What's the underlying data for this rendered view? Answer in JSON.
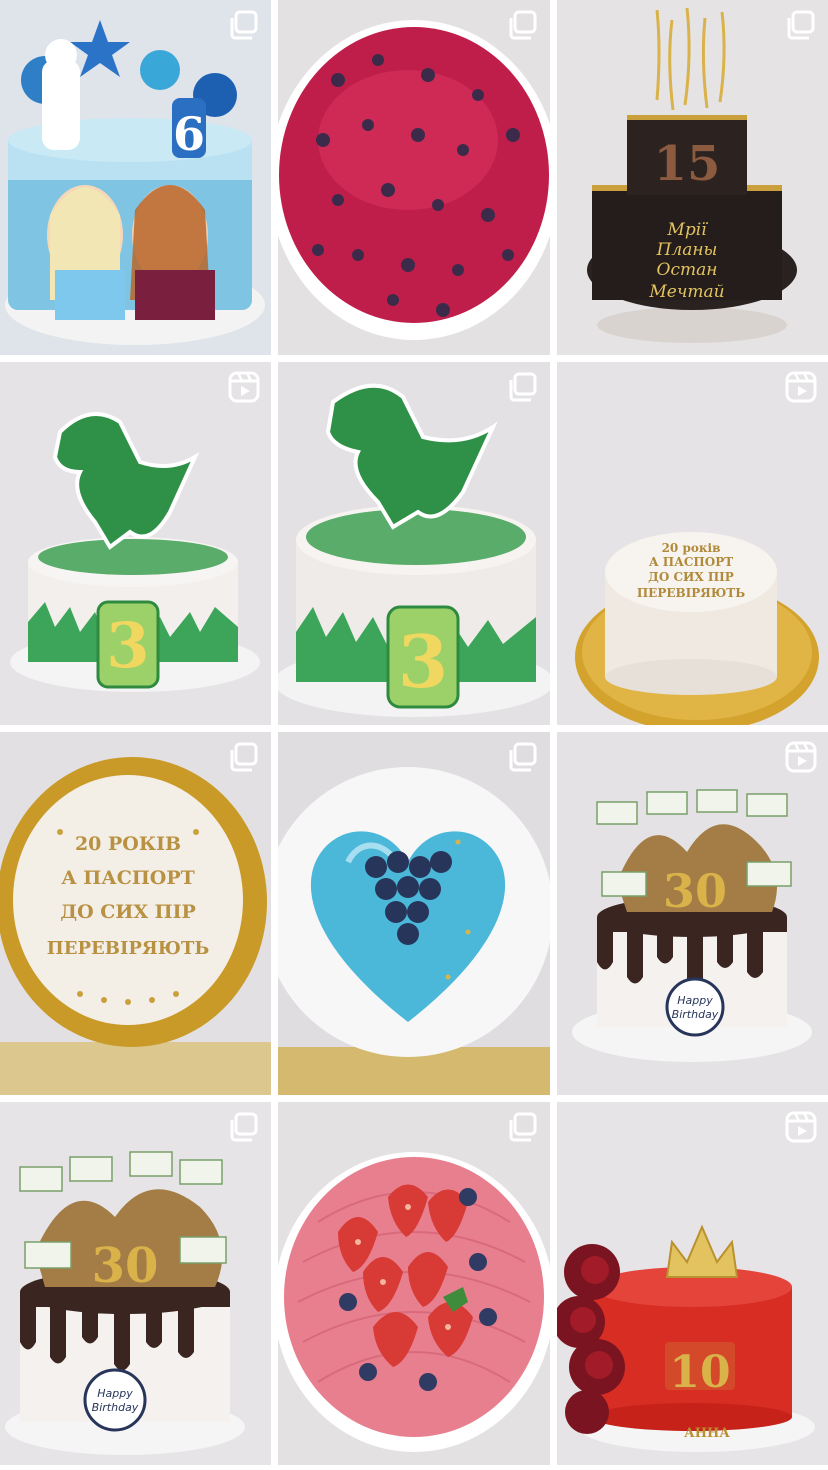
{
  "grid": {
    "columns": 3,
    "tiles": [
      {
        "name": "frozen-cake",
        "badge": "carousel-icon",
        "number": "6"
      },
      {
        "name": "berry-glaze-cake",
        "badge": "carousel-icon"
      },
      {
        "name": "black-gold-cake",
        "badge": "carousel-icon",
        "number": "15",
        "script_lines": [
          "Мрії",
          "Планы",
          "Остан",
          "Мечтай"
        ]
      },
      {
        "name": "dino-cake-1",
        "badge": "reels-icon",
        "number": "3"
      },
      {
        "name": "dino-cake-2",
        "badge": "carousel-icon",
        "number": "3"
      },
      {
        "name": "passport-cake-side",
        "badge": "reels-icon",
        "text_lines": [
          "20 років",
          "А ПАСПОРТ",
          "ДО СИХ ПІР",
          "ПЕРЕВІРЯЮТЬ"
        ]
      },
      {
        "name": "passport-cake-top",
        "badge": "carousel-icon",
        "text_lines": [
          "20 РОКІВ",
          "А ПАСПОРТ",
          "ДО СИХ ПІР",
          "ПЕРЕВІРЯЮТЬ"
        ]
      },
      {
        "name": "heart-mousse-cake",
        "badge": "carousel-icon"
      },
      {
        "name": "money-cake-30-a",
        "badge": "reels-icon",
        "number": "30",
        "topper_lines": [
          "Happy",
          "Birthday"
        ]
      },
      {
        "name": "money-cake-30-b",
        "badge": "carousel-icon",
        "number": "30",
        "topper_lines": [
          "Happy",
          "Birthday"
        ]
      },
      {
        "name": "strawberry-cake",
        "badge": "carousel-icon"
      },
      {
        "name": "red-crown-cake",
        "badge": "reels-icon",
        "number": "10",
        "name_label": "АННА"
      }
    ]
  },
  "colors": {
    "badge": "#ffffff",
    "backdrop": "#e7e4e6",
    "gold": "#c9a03c"
  }
}
